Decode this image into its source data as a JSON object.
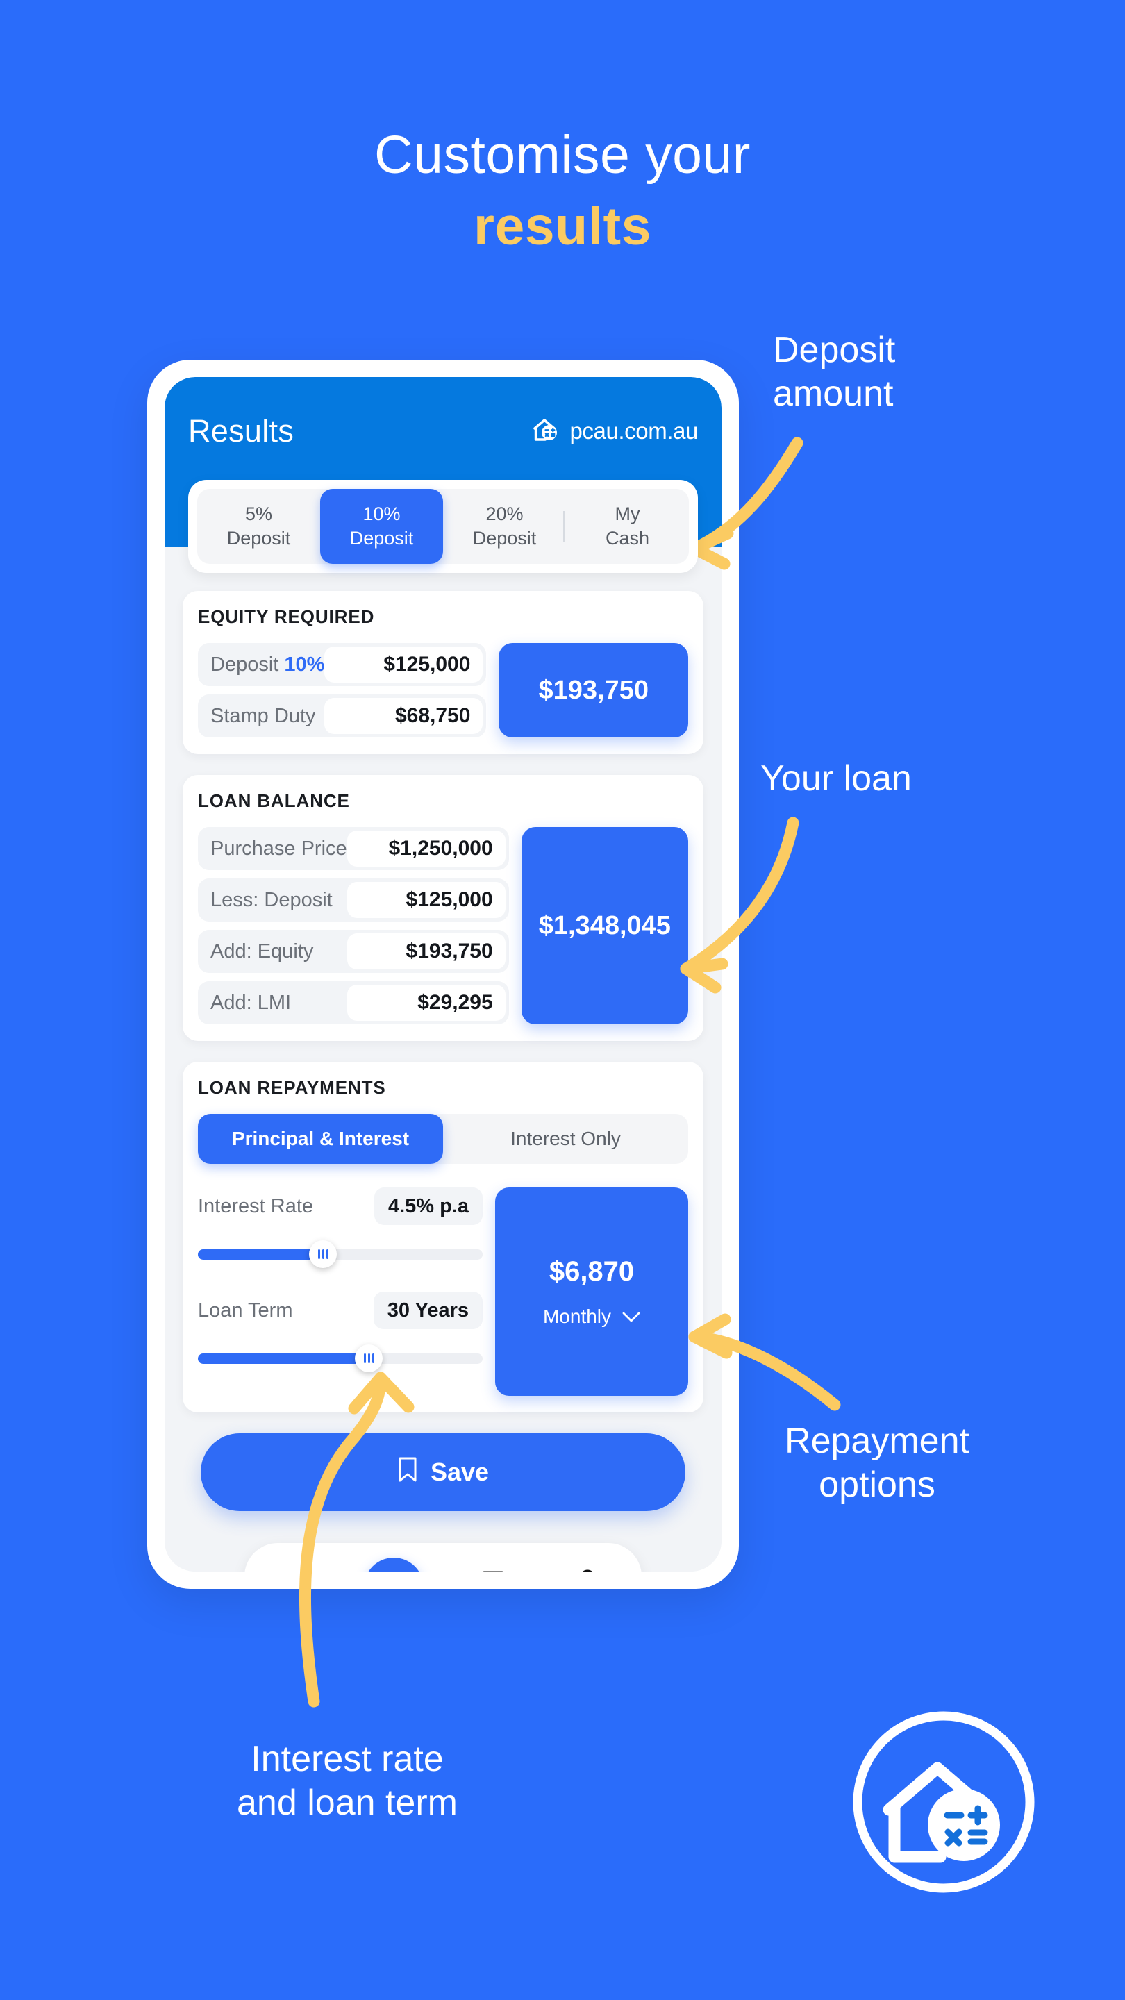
{
  "colors": {
    "background": "#2A6CFA",
    "header_blue": "#0579DF",
    "accent_blue": "#2F6BF6",
    "accent_yellow": "#FBCB62",
    "card_white": "#FFFFFF",
    "panel_grey": "#F2F4F7",
    "text_dark": "#14171C",
    "text_muted": "#6B7078"
  },
  "headline": {
    "line1": "Customise your",
    "line2": "results"
  },
  "phone": {
    "header": {
      "title": "Results",
      "brand_name": "pcau.com.au",
      "brand_icon": "house-calculator-icon"
    },
    "deposit_tabs": {
      "items": [
        {
          "line1": "5%",
          "line2": "Deposit",
          "active": false
        },
        {
          "line1": "10%",
          "line2": "Deposit",
          "active": true
        },
        {
          "line1": "20%",
          "line2": "Deposit",
          "active": false
        },
        {
          "line1": "My",
          "line2": "Cash",
          "active": false
        }
      ]
    },
    "equity_card": {
      "title": "EQUITY REQUIRED",
      "rows": [
        {
          "label": "Deposit ",
          "label_accent": "10%",
          "value": "$125,000"
        },
        {
          "label": "Stamp Duty",
          "label_accent": "",
          "value": "$68,750"
        }
      ],
      "total": "$193,750"
    },
    "loan_balance_card": {
      "title": "LOAN BALANCE",
      "rows": [
        {
          "label": "Purchase Price",
          "value": "$1,250,000"
        },
        {
          "label": "Less: Deposit",
          "value": "$125,000"
        },
        {
          "label": "Add: Equity",
          "value": "$193,750"
        },
        {
          "label": "Add: LMI",
          "value": "$29,295"
        }
      ],
      "total": "$1,348,045"
    },
    "repayments_card": {
      "title": "LOAN REPAYMENTS",
      "segments": [
        {
          "label": "Principal & Interest",
          "active": true
        },
        {
          "label": "Interest Only",
          "active": false
        }
      ],
      "interest_rate": {
        "label": "Interest Rate",
        "value": "4.5% p.a",
        "slider_percent": 44
      },
      "loan_term": {
        "label": "Loan Term",
        "value": "30 Years",
        "slider_percent": 60
      },
      "repayment_amount": "$6,870",
      "repayment_frequency": "Monthly",
      "frequency_icon": "chevron-down-icon"
    },
    "save_button": {
      "label": "Save",
      "icon": "bookmark-icon"
    },
    "bottom_nav": [
      {
        "icon": "home-icon",
        "active": false
      },
      {
        "icon": "calculator-icon",
        "active": true
      },
      {
        "icon": "bookmark-icon",
        "active": false
      },
      {
        "icon": "account-settings-icon",
        "active": false
      }
    ]
  },
  "callouts": {
    "deposit": "Deposit\namount",
    "loan": "Your loan",
    "repayment": "Repayment\noptions",
    "rate": "Interest rate\nand loan term"
  },
  "corner_logo": {
    "icon": "house-calculator-circle-logo"
  }
}
